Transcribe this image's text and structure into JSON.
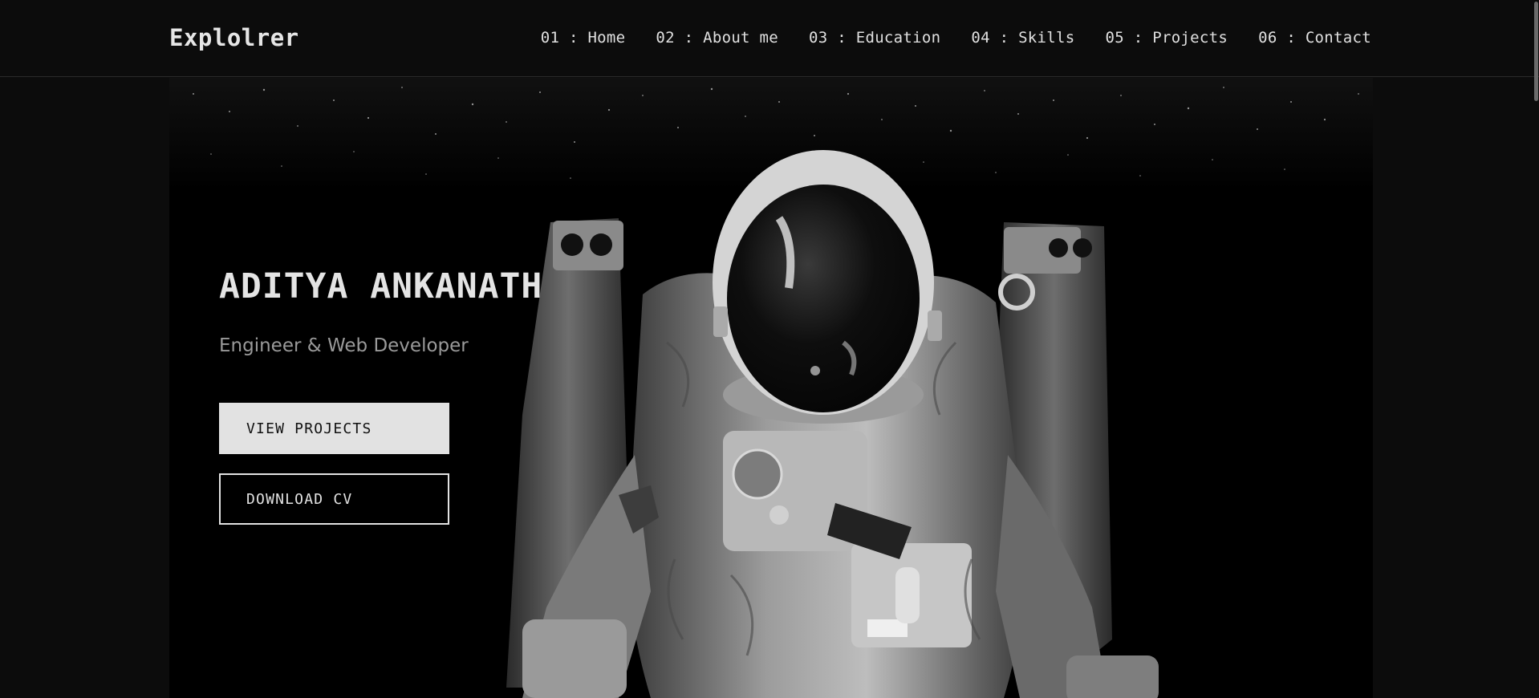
{
  "header": {
    "logo": "Explolrer",
    "nav": [
      {
        "label": "01 : Home"
      },
      {
        "label": "02 : About me"
      },
      {
        "label": "03 : Education"
      },
      {
        "label": "04 : Skills"
      },
      {
        "label": "05 : Projects"
      },
      {
        "label": "06 : Contact"
      }
    ]
  },
  "hero": {
    "name": "ADITYA ANKANATH",
    "subtitle": "Engineer & Web Developer",
    "primary_button": "VIEW PROJECTS",
    "secondary_button": "DOWNLOAD CV",
    "image": "astronaut-photo"
  },
  "colors": {
    "background": "#0c0c0c",
    "hero_background": "#000000",
    "text": "#e4e4e4",
    "muted_text": "#9a9a9a"
  }
}
